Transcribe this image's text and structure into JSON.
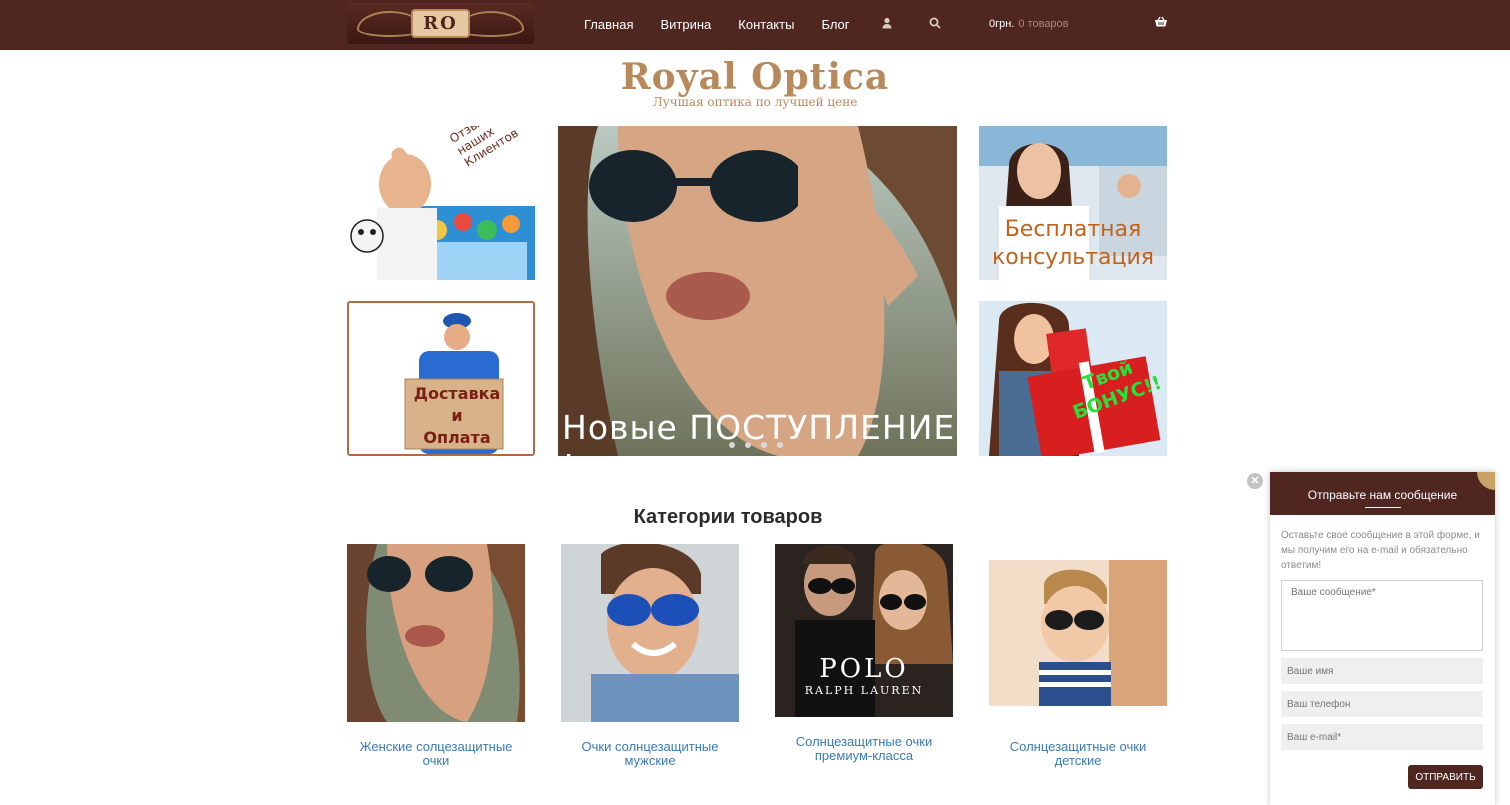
{
  "header": {
    "logo_text": "RO",
    "nav": [
      {
        "label": "Главная"
      },
      {
        "label": "Витрина"
      },
      {
        "label": "Контакты"
      },
      {
        "label": "Блог"
      }
    ],
    "cart_sum": "0грн.",
    "cart_count": "0 товаров",
    "icons": [
      "user-icon",
      "search-icon",
      "cart-icon"
    ],
    "colors": {
      "bar": "#4f2620",
      "accent": "#c9a266"
    }
  },
  "brand": {
    "title": "Royal Optica",
    "subtitle": "Лучшая оптика по лучшей цене"
  },
  "promos": {
    "reviews": "Отзывы наших Клиентов",
    "delivery": {
      "line1": "Доставка",
      "line2": "и",
      "line3": "Оплата"
    },
    "consultation": {
      "line1": "Бесплатная",
      "line2": "консультация"
    },
    "bonus": {
      "line1": "Твой",
      "line2": "БОНУС!!"
    }
  },
  "slider": {
    "caption": "Новые ПОСТУПЛЕНИЕ !",
    "dots": 4,
    "active_dot": 1
  },
  "categories": {
    "title": "Категории товаров",
    "items": [
      {
        "label": "Женские солцезащитные очки"
      },
      {
        "label": "Очки солнцезащитные мужские"
      },
      {
        "label": "Солнцезащитные очки премиум-класса",
        "image_text": {
          "line1": "POLO",
          "line2": "RALPH LAUREN"
        }
      },
      {
        "label": "Солнцезащитные очки детские"
      }
    ]
  },
  "widget": {
    "title": "Отправьте нам сообщение",
    "intro": "Оставьте свое сообщение в этой форме, и мы получим его на e-mail и обязательно ответим!",
    "message_placeholder": "Ваше сообщение*",
    "name_placeholder": "Ваше имя",
    "phone_placeholder": "Ваш телефон",
    "email_placeholder": "Ваш e-mail*",
    "submit_label": "ОТПРАВИТЬ"
  }
}
